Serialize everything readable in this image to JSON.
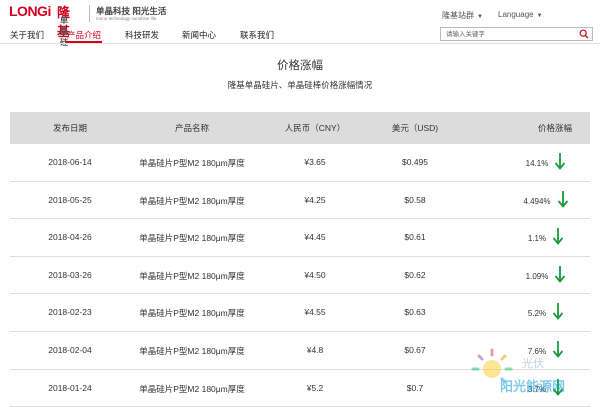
{
  "brand": {
    "logo_latin": "LONGi",
    "logo_cn": "隆基",
    "logo_cn_sub": "单晶硅",
    "slogan": "单晶科技 阳光生活",
    "slogan_en": "mono technology sunshine life"
  },
  "utility": {
    "sites_label": "隆基站群",
    "language_label": "Language"
  },
  "nav": {
    "items": [
      "关于我们",
      "产品介绍",
      "科技研发",
      "新闻中心",
      "联系我们"
    ],
    "active_index": 1
  },
  "search": {
    "placeholder": "请输入关键字"
  },
  "page": {
    "title": "价格涨幅",
    "subtitle": "隆基单晶硅片、单晶硅棒价格涨幅情况"
  },
  "table": {
    "headers": [
      "发布日期",
      "产品名称",
      "人民币（CNY）",
      "美元（USD)",
      "价格涨幅"
    ],
    "rows": [
      {
        "date": "2018-06-14",
        "product": "单晶硅片P型M2 180μm厚度",
        "cny": "¥3.65",
        "usd": "$0.495",
        "change": "14.1%"
      },
      {
        "date": "2018-05-25",
        "product": "单晶硅片P型M2 180μm厚度",
        "cny": "¥4.25",
        "usd": "$0.58",
        "change": "4.494%"
      },
      {
        "date": "2018-04-26",
        "product": "单晶硅片P型M2 180μm厚度",
        "cny": "¥4.45",
        "usd": "$0.61",
        "change": "1.1%"
      },
      {
        "date": "2018-03-26",
        "product": "单晶硅片P型M2 180μm厚度",
        "cny": "¥4.50",
        "usd": "$0.62",
        "change": "1.09%"
      },
      {
        "date": "2018-02-23",
        "product": "单晶硅片P型M2 180μm厚度",
        "cny": "¥4.55",
        "usd": "$0.63",
        "change": "5.2%"
      },
      {
        "date": "2018-02-04",
        "product": "单晶硅片P型M2 180μm厚度",
        "cny": "¥4.8",
        "usd": "$0.67",
        "change": "7.6%"
      },
      {
        "date": "2018-01-24",
        "product": "单晶硅片P型M2 180μm厚度",
        "cny": "¥5.2",
        "usd": "$0.7",
        "change": "3.7%"
      }
    ]
  },
  "colors": {
    "brand_red": "#d2001f",
    "down_arrow": "#1a9a3a",
    "header_bg": "#dcdcdc"
  },
  "icons": {
    "search": "search-icon",
    "trend": "down-arrow-icon",
    "dropdown": "caret-down-icon"
  },
  "watermark": {
    "cn": "光伏",
    "text": "阳光能源网"
  }
}
